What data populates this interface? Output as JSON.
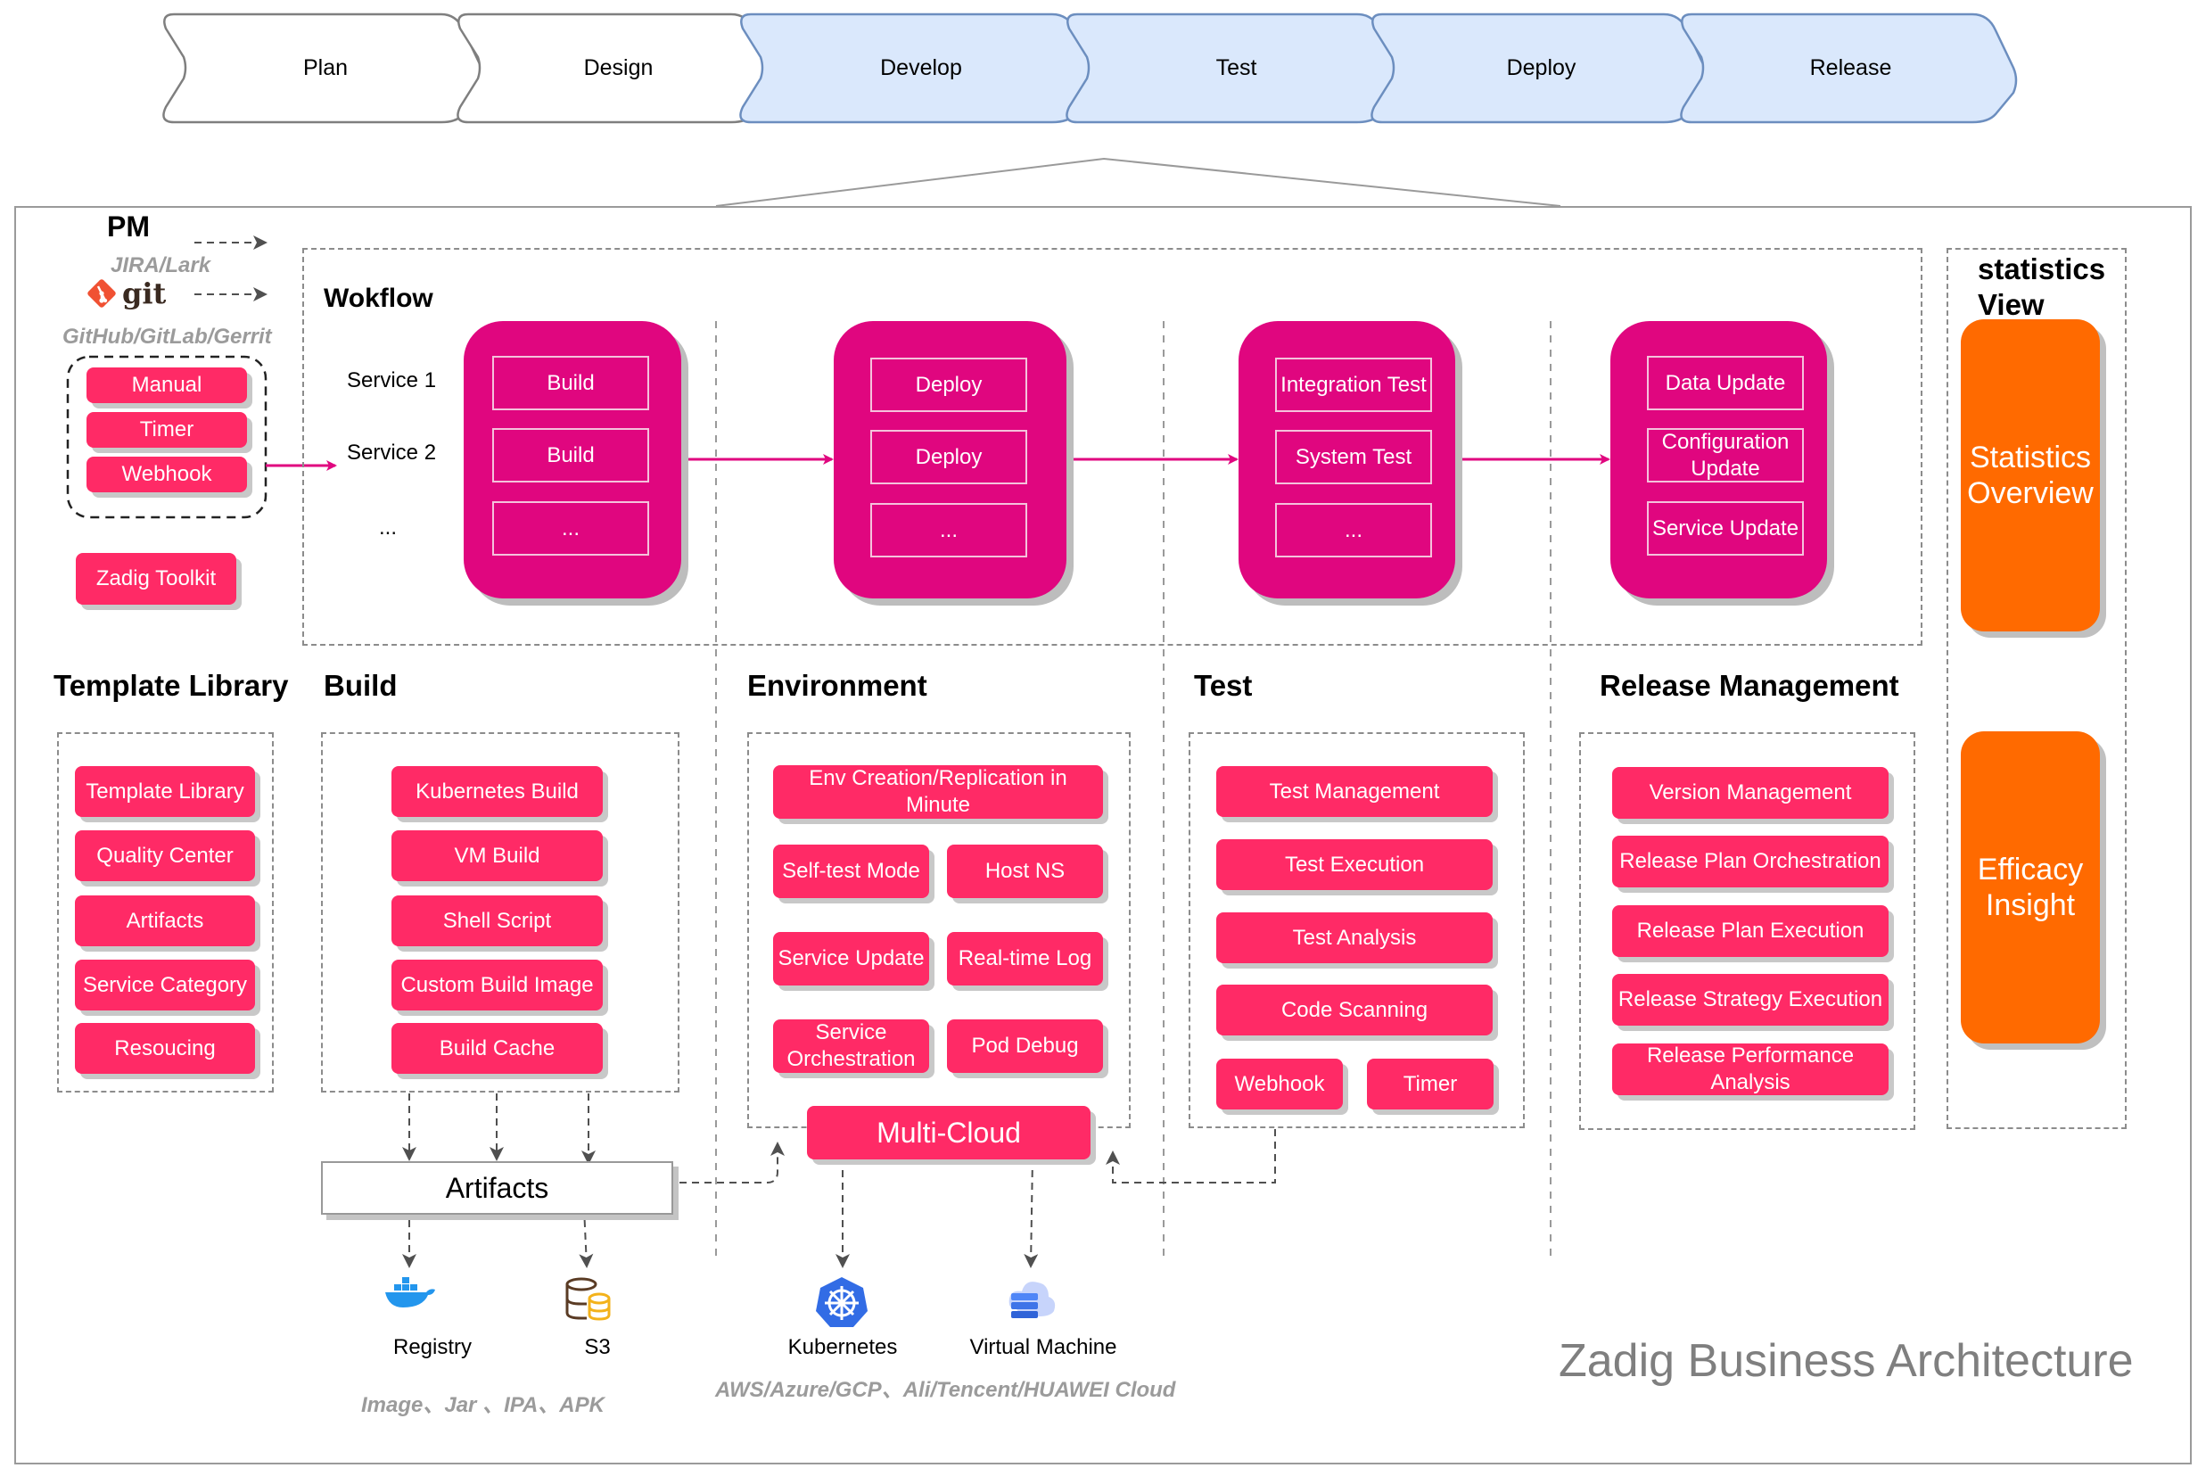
{
  "title": "Zadig Business Architecture",
  "lifecycle": {
    "stages": [
      {
        "label": "Plan",
        "highlighted": false
      },
      {
        "label": "Design",
        "highlighted": false
      },
      {
        "label": "Develop",
        "highlighted": true
      },
      {
        "label": "Test",
        "highlighted": true
      },
      {
        "label": "Deploy",
        "highlighted": true
      },
      {
        "label": "Release",
        "highlighted": true
      }
    ]
  },
  "sources": {
    "pm_label": "PM",
    "pm_tools": "JIRA/Lark",
    "git_label": "git",
    "git_tools": "GitHub/GitLab/Gerrit",
    "triggers": [
      "Manual",
      "Timer",
      "Webhook"
    ],
    "toolkit": "Zadig Toolkit"
  },
  "workflow": {
    "title": "Wokflow",
    "services": [
      "Service 1",
      "Service 2",
      "..."
    ],
    "stages": [
      {
        "name": "build",
        "items": [
          "Build",
          "Build",
          "..."
        ]
      },
      {
        "name": "deploy",
        "items": [
          "Deploy",
          "Deploy",
          "..."
        ]
      },
      {
        "name": "test",
        "items": [
          "Integration Test",
          "System Test",
          "..."
        ]
      },
      {
        "name": "release",
        "items": [
          "Data Update",
          "Configuration Update",
          "Service Update"
        ]
      }
    ]
  },
  "statistics": {
    "title": "statistics View",
    "cards": [
      "Statistics Overview",
      "Efficacy Insight"
    ]
  },
  "sections": {
    "template_library": {
      "title": "Template Library",
      "items": [
        "Template Library",
        "Quality Center",
        "Artifacts",
        "Service Category",
        "Resoucing"
      ]
    },
    "build": {
      "title": "Build",
      "items": [
        "Kubernetes Build",
        "VM Build",
        "Shell Script",
        "Custom Build Image",
        "Build Cache"
      ]
    },
    "environment": {
      "title": "Environment",
      "wide_item": "Env Creation/Replication in Minute",
      "items": [
        "Self-test Mode",
        "Host NS",
        "Service Update",
        "Real-time Log",
        "Service Orchestration",
        "Pod Debug"
      ]
    },
    "test": {
      "title": "Test",
      "items": [
        "Test Management",
        "Test Execution",
        "Test Analysis",
        "Code Scanning"
      ],
      "pair": [
        "Webhook",
        "Timer"
      ]
    },
    "release_management": {
      "title": "Release Management",
      "items": [
        "Version Management",
        "Release Plan Orchestration",
        "Release Plan Execution",
        "Release Strategy Execution",
        "Release Performance Analysis"
      ]
    }
  },
  "artifacts": {
    "label": "Artifacts",
    "targets": [
      "Registry",
      "S3"
    ],
    "types_note": "Image、Jar 、IPA、APK"
  },
  "multicloud": {
    "label": "Multi-Cloud",
    "targets": [
      "Kubernetes",
      "Virtual Machine"
    ],
    "providers_note": "AWS/Azure/GCP、Ali/Tencent/HUAWEI Cloud"
  },
  "colors": {
    "pill": "#FF2A66",
    "workflow_card": "#E0067F",
    "stats_card": "#FF6A00",
    "stage_active_fill": "#DAE8FC",
    "stage_active_stroke": "#6C8EBF",
    "stage_inactive_stroke": "#7f7f7f"
  }
}
